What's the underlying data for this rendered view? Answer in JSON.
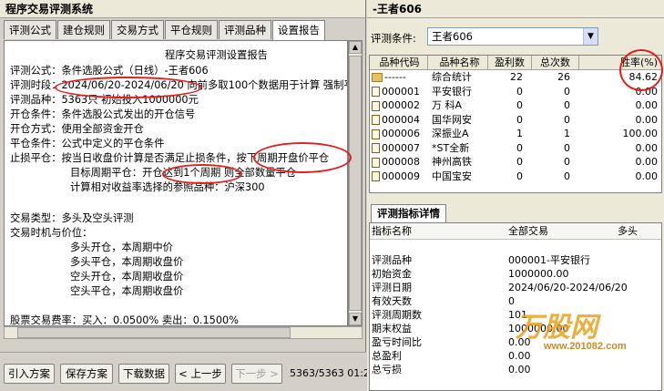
{
  "left_window": {
    "title": "程序交易评测系统",
    "tabs": [
      "评测公式",
      "建仓规则",
      "交易方式",
      "平仓规则",
      "评测品种",
      "设置报告"
    ],
    "report": {
      "heading": "程序交易评测设置报告",
      "lines": [
        "评测公式：条件选股公式（日线）-王者606",
        "评测时段：2024/06/20-2024/06/20 向前多取100个数据用于计算 强制平仓",
        "评测品种：5363只 初始投入1000000元",
        "开仓条件：条件选股公式发出的开仓信号",
        "开仓方式：使用全部资金开仓",
        "平仓条件：公式中定义的平仓条件",
        "止损平仓：按当日收盘价计算是否满足止损条件，按下周期开盘价平仓",
        "目标周期平仓：开仓达到1个周期 则全部数量平仓",
        "计算相对收益率选择的参照品种：沪深300",
        "",
        "交易类型：多头及空头评测",
        "交易时机与价位：",
        "多头开仓，本周期中价",
        "多头平仓，本周期收盘价",
        "空头开仓，本周期收盘价",
        "空头平仓，本周期收盘价",
        "",
        "股票交易费率：买入：0.0500% 卖出：0.1500%"
      ]
    },
    "buttons": {
      "import": "引入方案",
      "save": "保存方案",
      "download": "下载数据",
      "prev": "< 上一步",
      "next": "下一步 >"
    },
    "status": "5363/5363  01:2"
  },
  "right_window": {
    "title": "-王者606",
    "condition_label": "评测条件:",
    "condition_value": "王者606",
    "grid": {
      "headers": [
        "品种代码",
        "品种名称",
        "盈利数",
        "总次数",
        "胜率(%)"
      ],
      "rows": [
        {
          "code": "------",
          "name": "综合统计",
          "profit": "22",
          "total": "26",
          "rate": "84.62",
          "icon": "folder"
        },
        {
          "code": "000001",
          "name": "平安银行",
          "profit": "0",
          "total": "0",
          "rate": "0.00",
          "icon": "file"
        },
        {
          "code": "000002",
          "name": "万 科A",
          "profit": "0",
          "total": "0",
          "rate": "0.00",
          "icon": "file"
        },
        {
          "code": "000004",
          "name": "国华网安",
          "profit": "0",
          "total": "0",
          "rate": "0.00",
          "icon": "file"
        },
        {
          "code": "000006",
          "name": "深振业A",
          "profit": "1",
          "total": "1",
          "rate": "100.00",
          "icon": "file"
        },
        {
          "code": "000007",
          "name": "*ST全新",
          "profit": "0",
          "total": "0",
          "rate": "0.00",
          "icon": "file"
        },
        {
          "code": "000008",
          "name": "神州高铁",
          "profit": "0",
          "total": "0",
          "rate": "0.00",
          "icon": "file"
        },
        {
          "code": "000009",
          "name": "中国宝安",
          "profit": "0",
          "total": "0",
          "rate": "0.00",
          "icon": "file"
        }
      ]
    },
    "detail_tab": "评测指标详情",
    "detail": {
      "headers": [
        "指标名称",
        "全部交易",
        "多头"
      ],
      "rows": [
        {
          "name": "",
          "value": ""
        },
        {
          "name": "评测品种",
          "value": "000001-平安银行"
        },
        {
          "name": "初始资金",
          "value": "1000000.00"
        },
        {
          "name": "评测日期",
          "value": "2024/06/20-2024/06/20"
        },
        {
          "name": "有效天数",
          "value": "0"
        },
        {
          "name": "评测周期数",
          "value": "101"
        },
        {
          "name": "期末权益",
          "value": "1000000.00"
        },
        {
          "name": "盈亏时间比",
          "value": "0.00"
        },
        {
          "name": "总盈利",
          "value": "0.00"
        },
        {
          "name": "总亏损",
          "value": "0.00"
        }
      ]
    }
  },
  "watermark": {
    "logo": "万股网",
    "url": "www.201082.com"
  }
}
